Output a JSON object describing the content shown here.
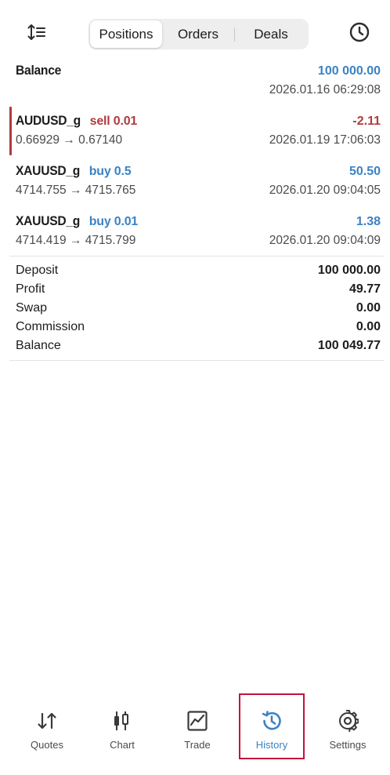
{
  "header": {
    "tabs": [
      {
        "label": "Positions",
        "active": true
      },
      {
        "label": "Orders",
        "active": false
      },
      {
        "label": "Deals",
        "active": false
      }
    ],
    "sort_icon": "sort-icon",
    "clock_icon": "clock-icon"
  },
  "balance_row": {
    "title": "Balance",
    "amount": "100 000.00",
    "time": "2026.01.16 06:29:08"
  },
  "deals": [
    {
      "symbol": "AUDUSD_g",
      "side": "sell 0.01",
      "prices": "0.66929 → 0.67140",
      "profit": "-2.11",
      "time": "2026.01.19 17:06:03",
      "direction": "sell"
    },
    {
      "symbol": "XAUUSD_g",
      "side": "buy 0.5",
      "prices": "4714.755 → 4715.765",
      "profit": "50.50",
      "time": "2026.01.20 09:04:05",
      "direction": "buy"
    },
    {
      "symbol": "XAUUSD_g",
      "side": "buy 0.01",
      "prices": "4714.419 → 4715.799",
      "profit": "1.38",
      "time": "2026.01.20 09:04:09",
      "direction": "buy"
    }
  ],
  "summary": [
    {
      "label": "Deposit",
      "value": "100 000.00"
    },
    {
      "label": "Profit",
      "value": "49.77"
    },
    {
      "label": "Swap",
      "value": "0.00"
    },
    {
      "label": "Commission",
      "value": "0.00"
    },
    {
      "label": "Balance",
      "value": "100 049.77"
    }
  ],
  "nav": [
    {
      "label": "Quotes",
      "icon": "quotes-icon"
    },
    {
      "label": "Chart",
      "icon": "chart-icon"
    },
    {
      "label": "Trade",
      "icon": "trade-icon"
    },
    {
      "label": "History",
      "icon": "history-icon",
      "active": true
    },
    {
      "label": "Settings",
      "icon": "settings-icon"
    }
  ],
  "colors": {
    "accent_blue": "#3b82c4",
    "sell_red": "#b03a3e",
    "highlight": "#c4123a"
  }
}
